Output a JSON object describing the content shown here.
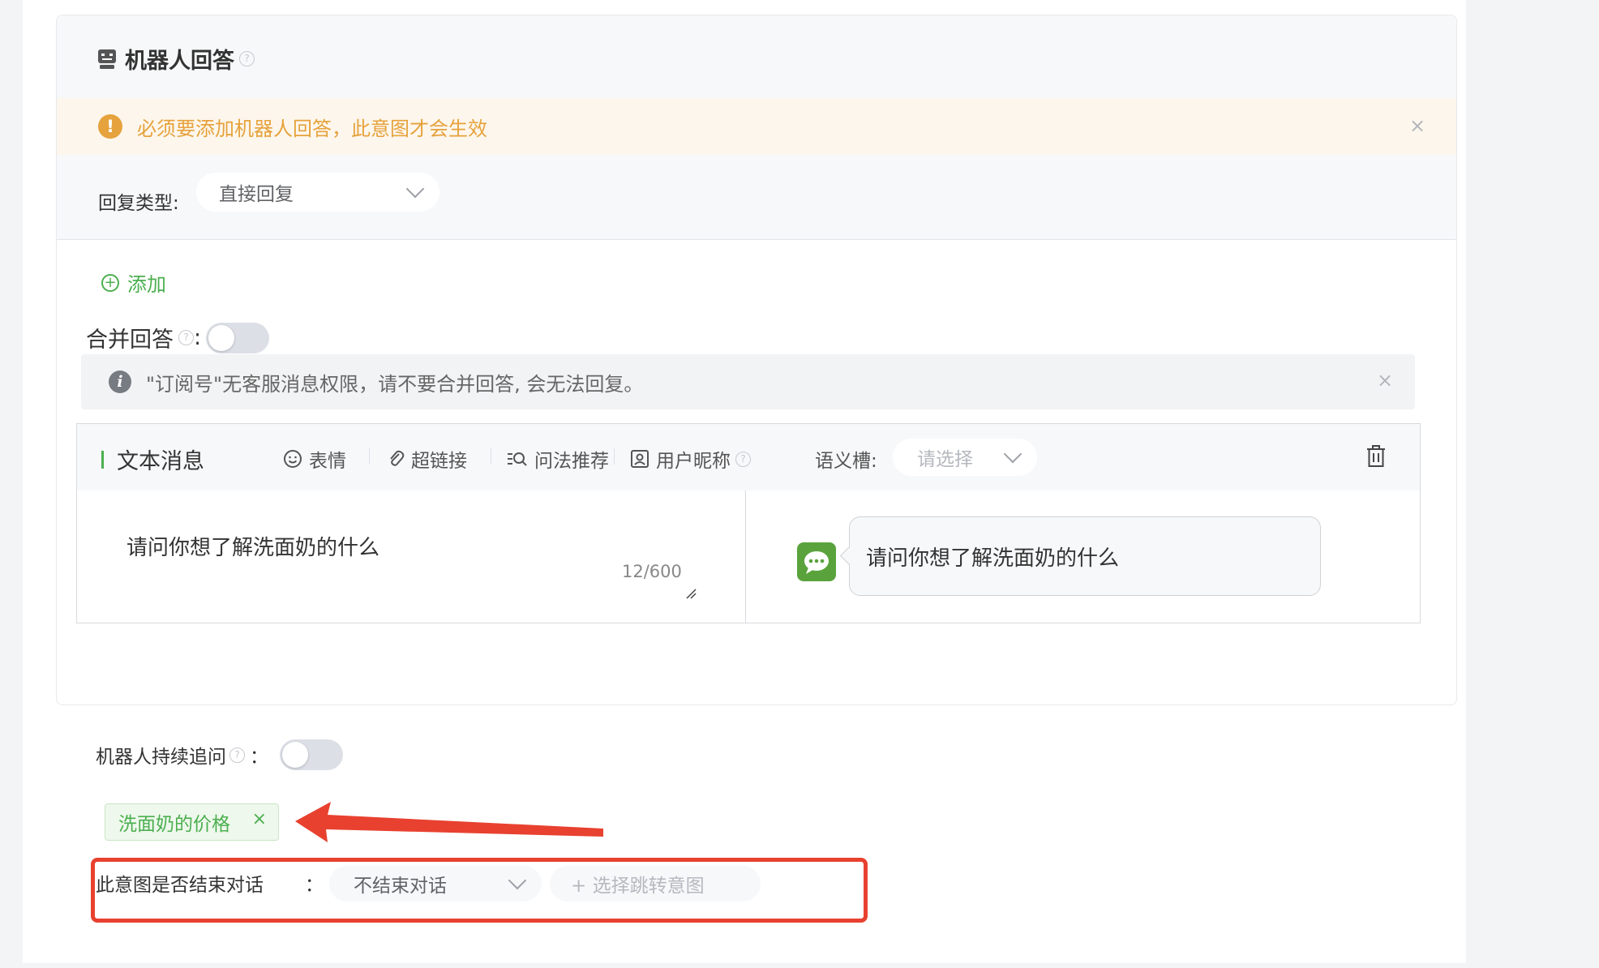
{
  "card": {
    "title": "机器人回答",
    "help": "?"
  },
  "warning": {
    "icon": "!",
    "text": "必须要添加机器人回答，此意图才会生效",
    "close": "×"
  },
  "reply_type": {
    "label": "回复类型:",
    "value": "直接回复"
  },
  "add_label": "添加",
  "merge": {
    "label": "合并回答",
    "help": "?",
    "colon": ":",
    "enabled": false
  },
  "info": {
    "icon": "i",
    "text": "\"订阅号\"无客服消息权限，请不要合并回答, 会无法回复。",
    "close": "×"
  },
  "message": {
    "title": "文本消息",
    "tools": {
      "emoji": "表情",
      "link": "超链接",
      "recommend": "问法推荐",
      "nickname": "用户昵称",
      "nickname_help": "?",
      "slot_label": "语义槽:",
      "slot_placeholder": "请选择"
    },
    "text": "请问你想了解洗面奶的什么",
    "counter": "12/600",
    "preview_text": "请问你想了解洗面奶的什么"
  },
  "follow_up": {
    "label": "机器人持续追问",
    "help": "?",
    "colon": "：",
    "enabled": false
  },
  "tag": {
    "label": "洗面奶的价格",
    "close": "×"
  },
  "end_dialog": {
    "label": "此意图是否结束对话",
    "colon": "：",
    "value": "不结束对话",
    "jump_placeholder": "+ 选择跳转意图"
  },
  "colors": {
    "accent_green": "#4caf50",
    "warning": "#e6a23c",
    "annotation_red": "#e8412f"
  }
}
